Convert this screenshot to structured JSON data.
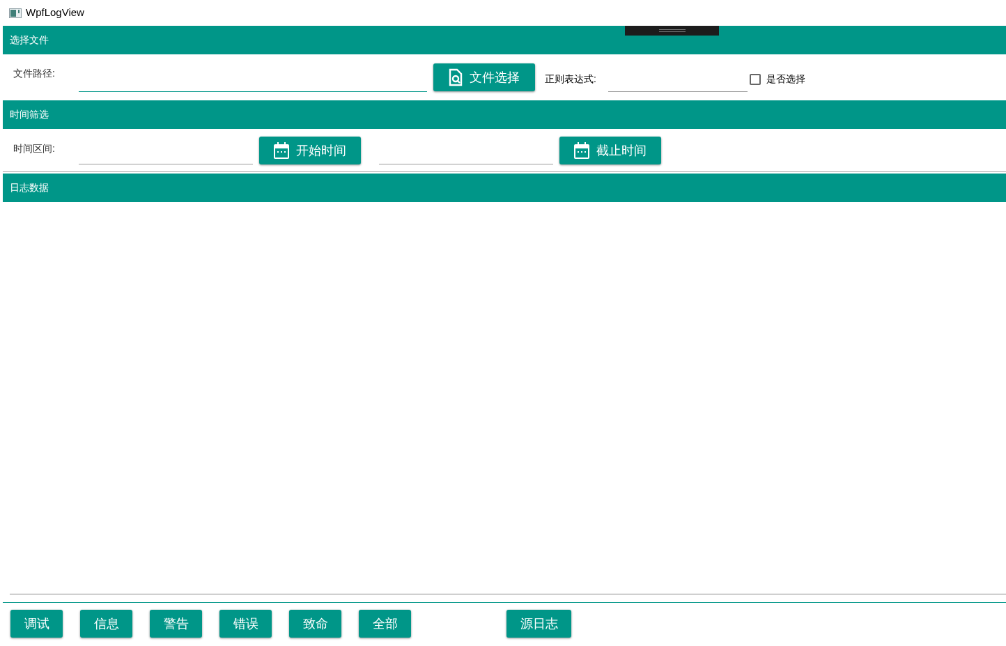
{
  "window": {
    "title": "WpfLogView"
  },
  "file_section": {
    "header": "选择文件",
    "path_label": "文件路径:",
    "path_field": {
      "focused": true
    },
    "pick_button": "文件选择",
    "regex_label": "正则表达式:",
    "checkbox": {
      "label": "是否选择",
      "checked": false
    }
  },
  "time_section": {
    "header": "时间筛选",
    "range_label": "时间区间:",
    "start_button": "开始时间",
    "end_button": "截止时间"
  },
  "log_section": {
    "header": "日志数据"
  },
  "level_buttons": [
    {
      "label": "调试",
      "kind": "level"
    },
    {
      "label": "信息",
      "kind": "level"
    },
    {
      "label": "警告",
      "kind": "level"
    },
    {
      "label": "错误",
      "kind": "level"
    },
    {
      "label": "致命",
      "kind": "level"
    },
    {
      "label": "全部",
      "kind": "level"
    },
    {
      "label": "源日志",
      "kind": "source"
    }
  ]
}
